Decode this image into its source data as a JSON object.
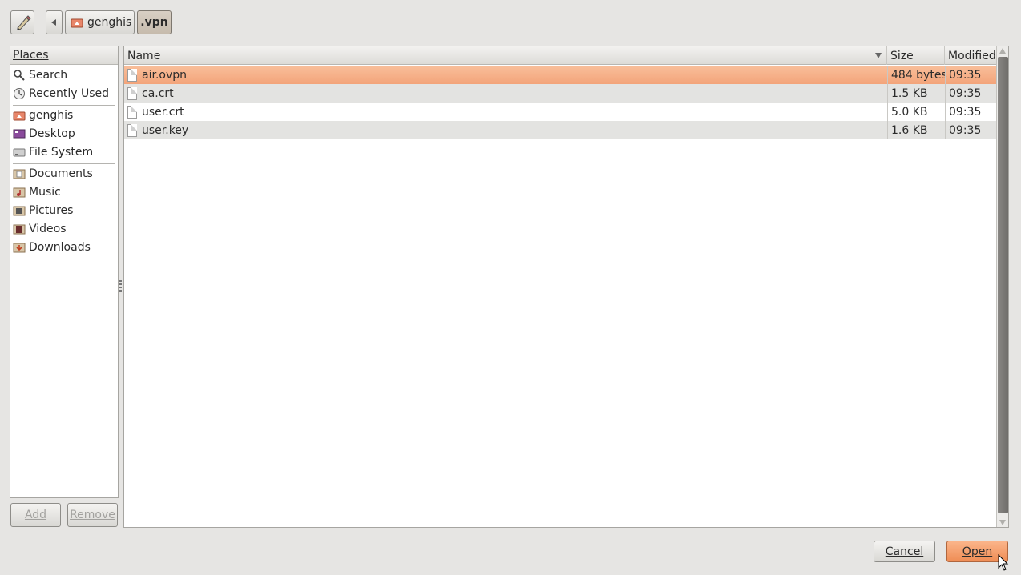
{
  "toolbar": {
    "edit_icon": "pencil-icon",
    "back_icon": "arrow-left-icon",
    "breadcrumbs": [
      {
        "label": "genghis",
        "icon": "home-folder-icon"
      },
      {
        "label": ".vpn",
        "active": true
      }
    ]
  },
  "places": {
    "header": "Places",
    "items": [
      {
        "label": "Search",
        "icon": "search-icon"
      },
      {
        "label": "Recently Used",
        "icon": "recent-icon"
      },
      {
        "label": "genghis",
        "icon": "home-folder-icon"
      },
      {
        "label": "Desktop",
        "icon": "desktop-icon"
      },
      {
        "label": "File System",
        "icon": "drive-icon"
      },
      {
        "label": "Documents",
        "icon": "documents-folder-icon"
      },
      {
        "label": "Music",
        "icon": "music-folder-icon"
      },
      {
        "label": "Pictures",
        "icon": "pictures-folder-icon"
      },
      {
        "label": "Videos",
        "icon": "videos-folder-icon"
      },
      {
        "label": "Downloads",
        "icon": "downloads-folder-icon"
      }
    ],
    "add_label": "Add",
    "remove_label": "Remove"
  },
  "files": {
    "columns": {
      "name": "Name",
      "size": "Size",
      "modified": "Modified"
    },
    "rows": [
      {
        "name": "air.ovpn",
        "size": "484 bytes",
        "modified": "09:35",
        "selected": true
      },
      {
        "name": "ca.crt",
        "size": "1.5 KB",
        "modified": "09:35"
      },
      {
        "name": "user.crt",
        "size": "5.0 KB",
        "modified": "09:35"
      },
      {
        "name": "user.key",
        "size": "1.6 KB",
        "modified": "09:35"
      }
    ]
  },
  "actions": {
    "cancel_label": "Cancel",
    "open_label": "Open"
  },
  "colors": {
    "selection": "#f3a47a",
    "open_button": "#ef8d55",
    "window_bg": "#e6e5e3"
  }
}
